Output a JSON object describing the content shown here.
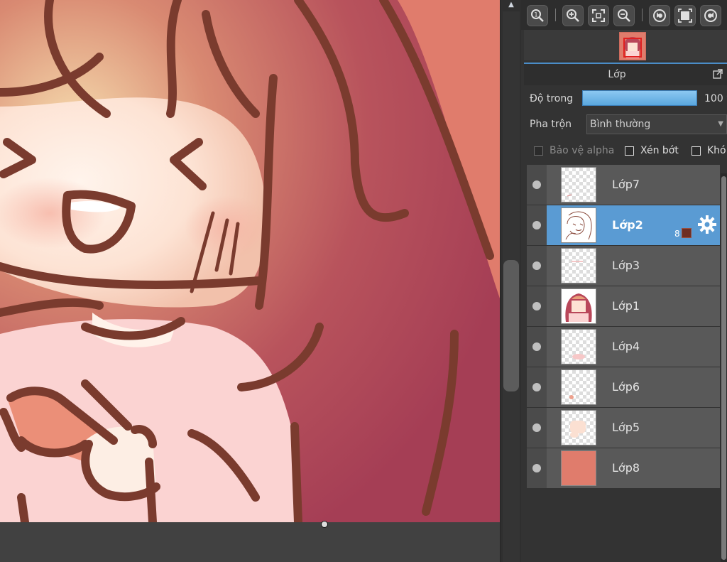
{
  "toolbar": {
    "buttons": [
      {
        "icon": "zoom-actual-size-icon"
      },
      {
        "icon": "zoom-in-icon"
      },
      {
        "icon": "fit-to-window-icon"
      },
      {
        "icon": "zoom-out-icon"
      },
      {
        "icon": "rotate-left-icon"
      },
      {
        "icon": "fullscreen-icon"
      },
      {
        "icon": "rotate-right-icon"
      }
    ]
  },
  "layers_panel": {
    "title": "Lớp",
    "opacity_label": "Độ trong",
    "opacity_value": "100 %",
    "opacity_fraction": 1.0,
    "blend_label": "Pha trộn",
    "blend_value": "Bình thường",
    "protect_alpha_label": "Bảo vệ alpha",
    "clipping_label": "Xén bớt",
    "lock_label": "Khó",
    "layers": [
      {
        "name": "Lớp7",
        "selected": false
      },
      {
        "name": "Lớp2",
        "selected": true,
        "badge_number": "8",
        "badge_color": "#6e2e22"
      },
      {
        "name": "Lớp3",
        "selected": false
      },
      {
        "name": "Lớp1",
        "selected": false
      },
      {
        "name": "Lớp4",
        "selected": false
      },
      {
        "name": "Lớp6",
        "selected": false
      },
      {
        "name": "Lớp5",
        "selected": false
      },
      {
        "name": "Lớp8",
        "selected": false
      }
    ]
  },
  "colors": {
    "accent": "#5a9bd3",
    "background_fill": "#e07c6c",
    "line_art": "#7a3b2e"
  }
}
